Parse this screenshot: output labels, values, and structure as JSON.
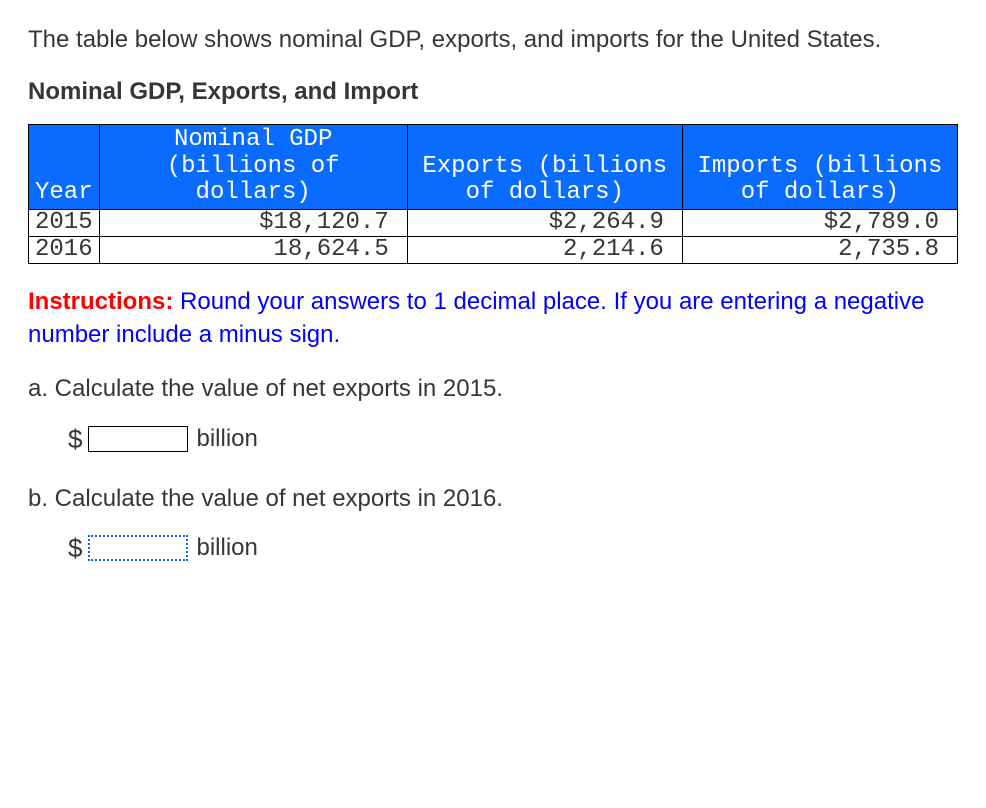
{
  "intro": "The table below shows nominal GDP, exports, and imports for the United States.",
  "title": "Nominal GDP, Exports, and Import",
  "table": {
    "headers": {
      "year": "Year",
      "gdp": "Nominal GDP (billions of dollars)",
      "exports": "Exports (billions of dollars)",
      "imports": "Imports (billions of dollars)"
    },
    "rows": [
      {
        "year": "2015",
        "gdp": "$18,120.7",
        "exports": "$2,264.9",
        "imports": "$2,789.0"
      },
      {
        "year": "2016",
        "gdp": "18,624.5",
        "exports": "2,214.6",
        "imports": "2,735.8"
      }
    ]
  },
  "instructions": {
    "lead": "Instructions:",
    "text": " Round your answers to 1 decimal place. If you are entering a negative number include a minus sign."
  },
  "questions": {
    "a": {
      "prompt": "a. Calculate the value of net exports in 2015.",
      "prefix": "$",
      "unit": "billion",
      "value": ""
    },
    "b": {
      "prompt": "b. Calculate the value of net exports in 2016.",
      "prefix": "$",
      "unit": "billion",
      "value": ""
    }
  },
  "chart_data": {
    "type": "table",
    "columns": [
      "Year",
      "Nominal GDP (billions of dollars)",
      "Exports (billions of dollars)",
      "Imports (billions of dollars)"
    ],
    "rows": [
      [
        "2015",
        18120.7,
        2264.9,
        2789.0
      ],
      [
        "2016",
        18624.5,
        2214.6,
        2735.8
      ]
    ]
  }
}
